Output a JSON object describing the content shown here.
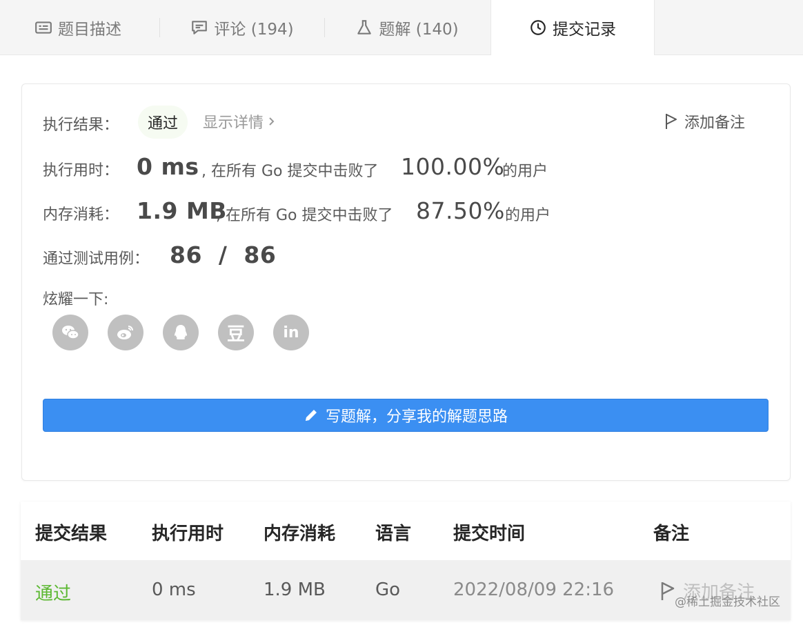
{
  "tabs": [
    {
      "label": "题目描述",
      "icon": "description-icon"
    },
    {
      "label": "评论 (194)",
      "icon": "comment-icon"
    },
    {
      "label": "题解 (140)",
      "icon": "flask-icon"
    },
    {
      "label": "提交记录",
      "icon": "clock-icon",
      "active": true
    }
  ],
  "result": {
    "label_result": "执行结果：",
    "status": "通过",
    "detail_link": "显示详情",
    "note_button": "添加备注",
    "label_runtime": "执行用时：",
    "runtime_value": "0 ms",
    "runtime_text": ", 在所有 Go 提交中击败了",
    "runtime_percent": "100.00%",
    "runtime_suffix": "的用户",
    "label_memory": "内存消耗：",
    "memory_value": "1.9 MB",
    "memory_text": ", 在所有 Go 提交中击败了",
    "memory_percent": "87.50%",
    "memory_suffix": "的用户",
    "label_cases": "通过测试用例：",
    "cases_value": "86  /  86",
    "label_share": "炫耀一下:",
    "share_icons": [
      "wechat-icon",
      "weibo-icon",
      "qq-icon",
      "douban-icon",
      "linkedin-icon"
    ],
    "douban_glyph": "豆",
    "linkedin_glyph": "in",
    "write_button": "写题解，分享我的解题思路"
  },
  "table": {
    "headers": [
      "提交结果",
      "执行用时",
      "内存消耗",
      "语言",
      "提交时间",
      "备注"
    ],
    "rows": [
      {
        "result": "通过",
        "runtime": "0 ms",
        "memory": "1.9 MB",
        "language": "Go",
        "time": "2022/08/09 22:16",
        "note": "添加备注"
      }
    ]
  },
  "watermark": "@稀土掘金技术社区",
  "colors": {
    "accent": "#3b8ff2",
    "success": "#5cb832",
    "tab_bg": "#f5f5f5",
    "row_bg": "#f0f0f0"
  }
}
